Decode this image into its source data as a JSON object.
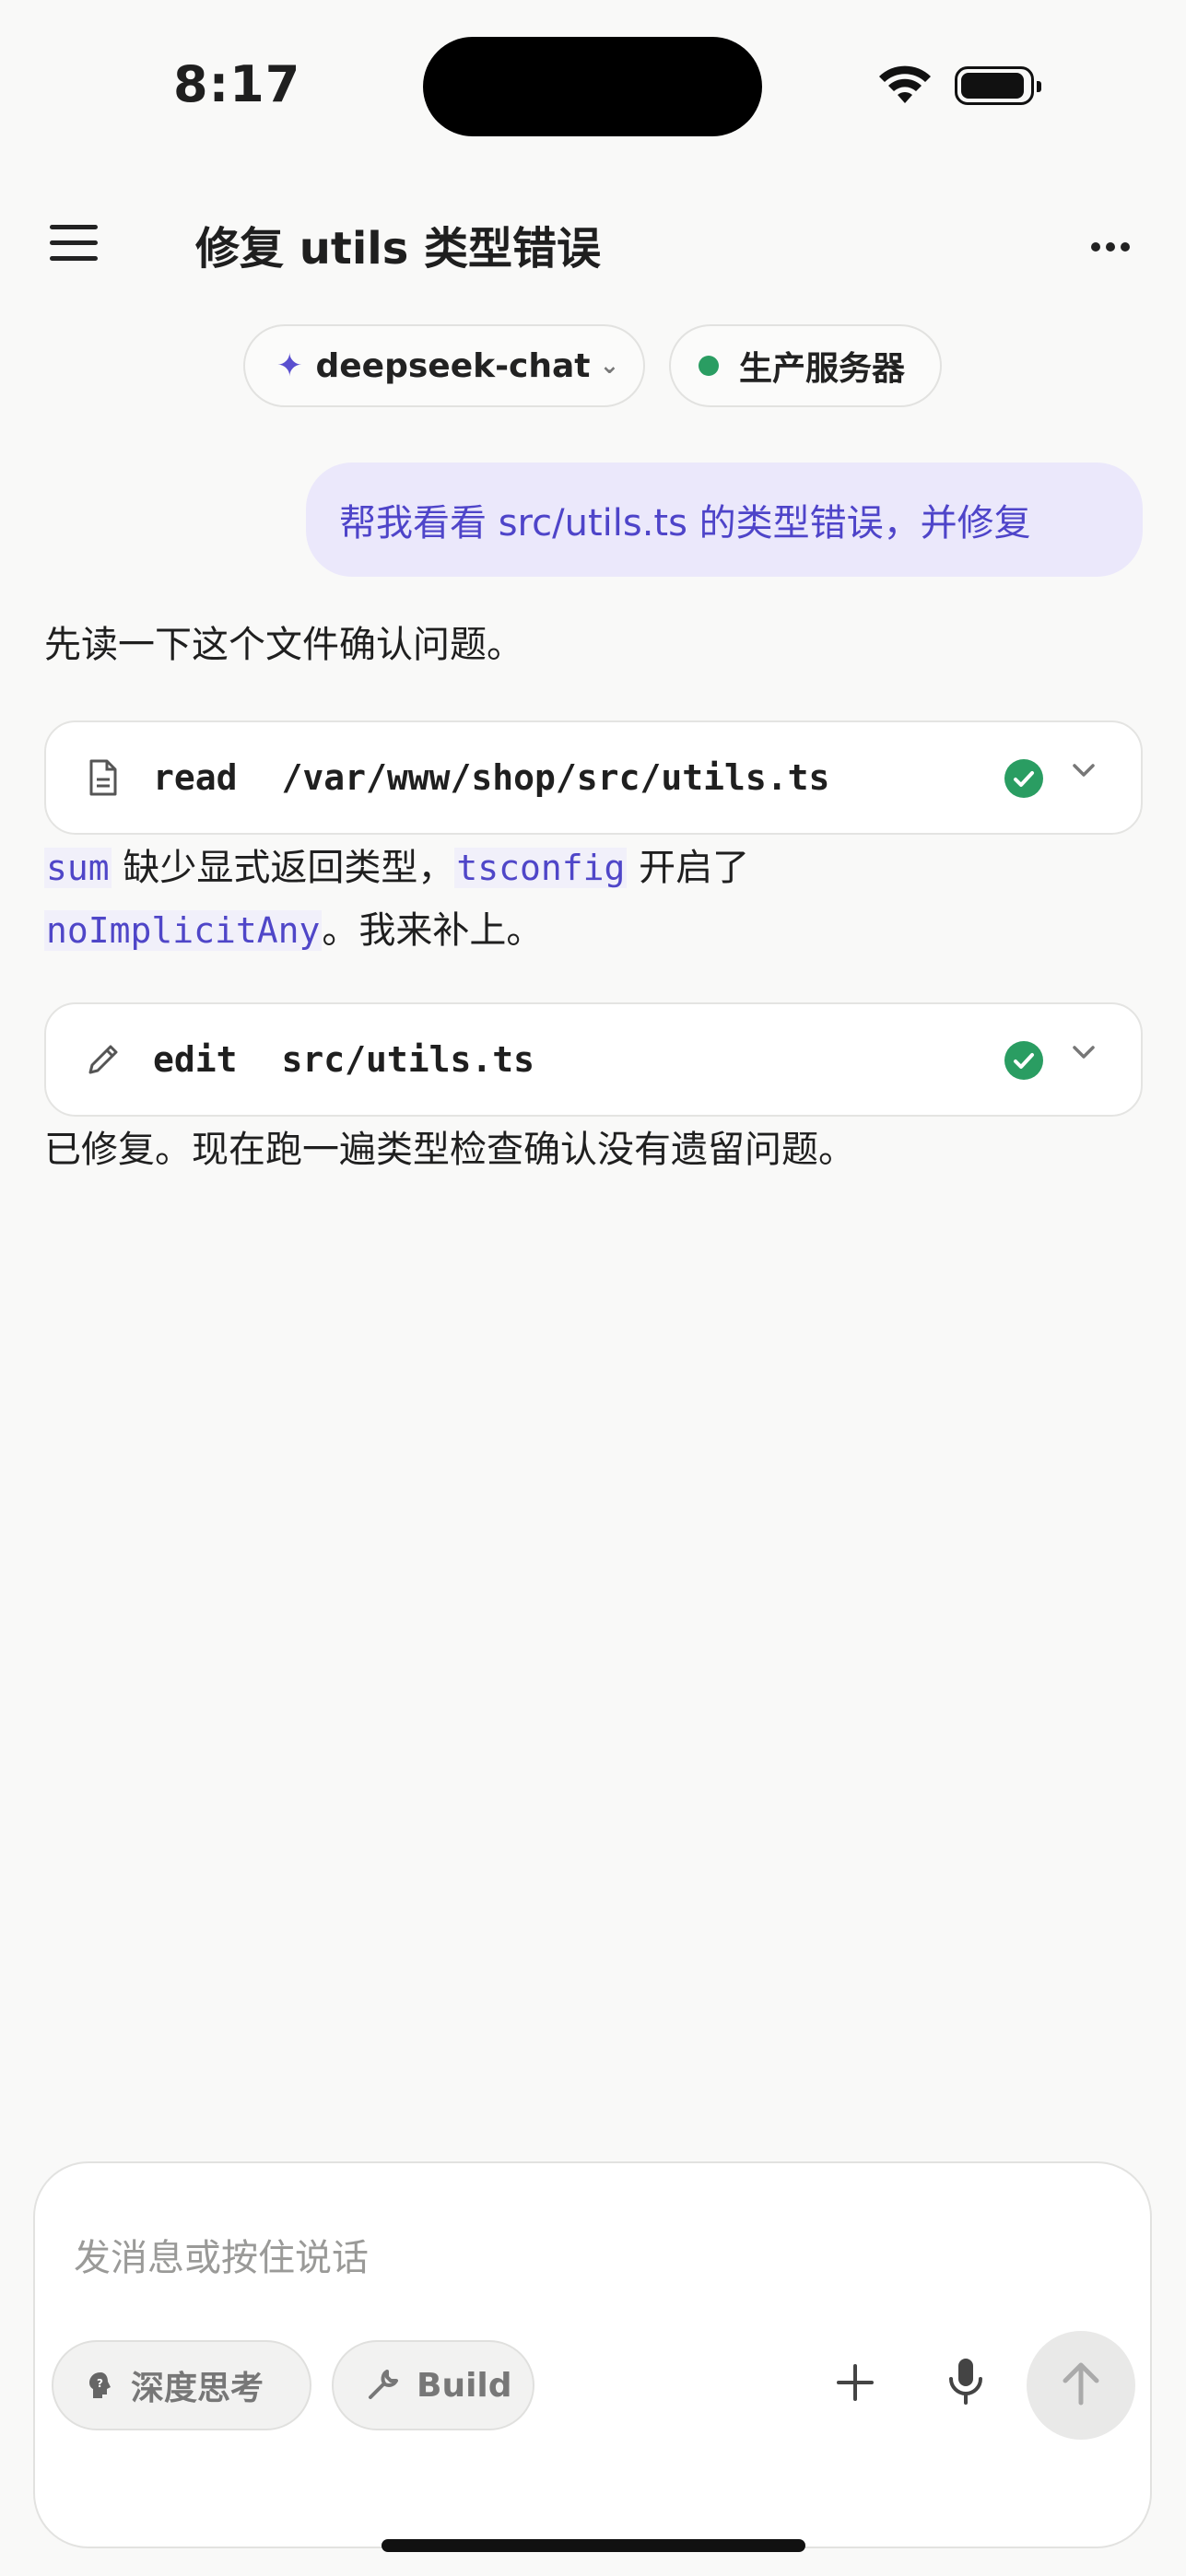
{
  "status_bar": {
    "time": "8:17"
  },
  "header": {
    "title": "修复 utils 类型错误"
  },
  "chips": {
    "model": "deepseek-chat",
    "server": "生产服务器",
    "server_status_color": "#2a9d62"
  },
  "messages": {
    "user": "帮我看看 src/utils.ts 的类型错误，并修复",
    "assistant_1": "先读一下这个文件确认问题。",
    "tool_1": {
      "name": "read",
      "path": "/var/www/shop/src/utils.ts",
      "icon": "document-icon",
      "status": "success"
    },
    "assistant_2": {
      "code_1": "sum",
      "text_1": " 缺少显式返回类型，",
      "code_2": "tsconfig",
      "text_2": " 开启了",
      "code_3": "noImplicitAny",
      "text_3": "。我来补上。"
    },
    "tool_2": {
      "name": "edit",
      "path": "src/utils.ts",
      "icon": "pencil-icon",
      "status": "success"
    },
    "assistant_3": "已修复。现在跑一遍类型检查确认没有遗留问题。"
  },
  "composer": {
    "placeholder": "发消息或按住说话",
    "think_label": "深度思考",
    "build_label": "Build"
  },
  "colors": {
    "accent": "#4e44c9",
    "user_bubble_bg": "#ebe8fb",
    "success": "#2a9d62",
    "background": "#f9f9f8"
  }
}
